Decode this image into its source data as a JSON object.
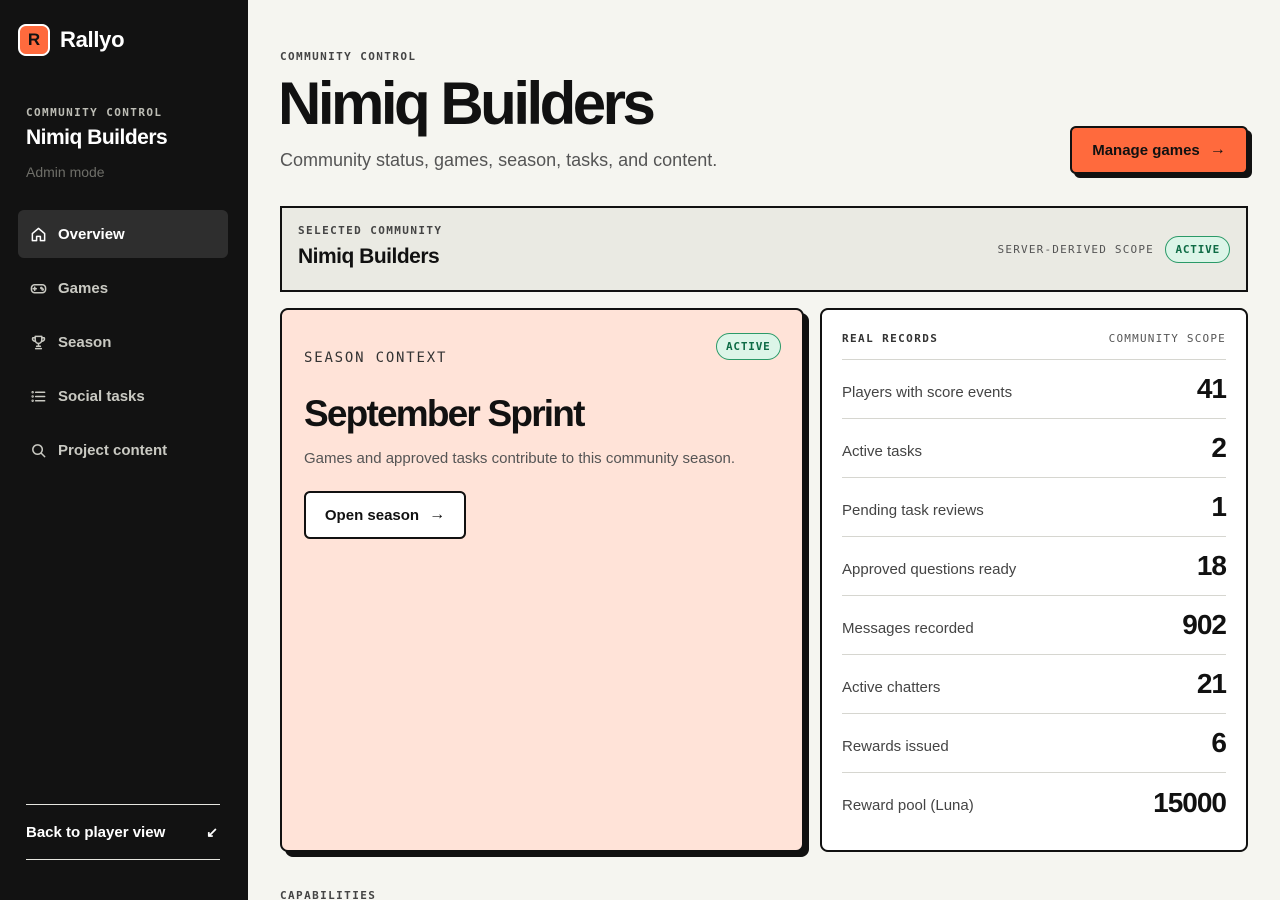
{
  "brand": {
    "logo_letter": "R",
    "name": "Rallyo",
    "accent": "#ff6a3d"
  },
  "sidebar": {
    "eyebrow": "COMMUNITY CONTROL",
    "community": "Nimiq Builders",
    "mode": "Admin mode",
    "items": [
      {
        "label": "Overview",
        "icon": "home-icon",
        "active": true
      },
      {
        "label": "Games",
        "icon": "gamepad-icon",
        "active": false
      },
      {
        "label": "Season",
        "icon": "trophy-icon",
        "active": false
      },
      {
        "label": "Social tasks",
        "icon": "list-icon",
        "active": false
      },
      {
        "label": "Project content",
        "icon": "search-icon",
        "active": false
      }
    ],
    "back_label": "Back to player view",
    "back_arrow": "↙"
  },
  "header": {
    "eyebrow": "COMMUNITY CONTROL",
    "title": "Nimiq Builders",
    "subtitle": "Community status, games, season, tasks, and content.",
    "manage_label": "Manage games",
    "manage_arrow": "→"
  },
  "selected": {
    "eyebrow": "SELECTED COMMUNITY",
    "name": "Nimiq Builders",
    "scope_label": "SERVER-DERIVED SCOPE",
    "badge": "ACTIVE"
  },
  "season": {
    "eyebrow": "SEASON CONTEXT",
    "badge": "ACTIVE",
    "title": "September Sprint",
    "description": "Games and approved tasks contribute to this community season.",
    "open_label": "Open season",
    "open_arrow": "→"
  },
  "records": {
    "eyebrow": "REAL RECORDS",
    "scope": "COMMUNITY SCOPE",
    "rows": [
      {
        "label": "Players with score events",
        "value": "41"
      },
      {
        "label": "Active tasks",
        "value": "2"
      },
      {
        "label": "Pending task reviews",
        "value": "1"
      },
      {
        "label": "Approved questions ready",
        "value": "18"
      },
      {
        "label": "Messages recorded",
        "value": "902"
      },
      {
        "label": "Active chatters",
        "value": "21"
      },
      {
        "label": "Rewards issued",
        "value": "6"
      },
      {
        "label": "Reward pool (Luna)",
        "value": "15000"
      }
    ]
  },
  "capabilities": {
    "eyebrow": "CAPABILITIES"
  }
}
